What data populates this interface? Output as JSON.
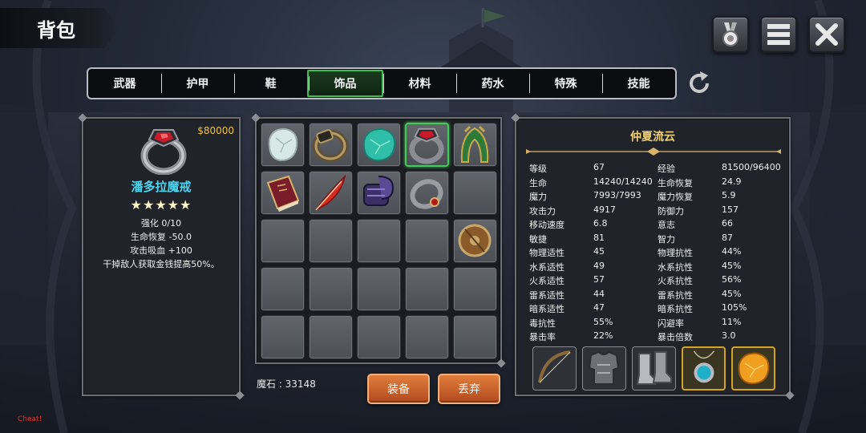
{
  "header": {
    "title": "背包"
  },
  "top_buttons": [
    {
      "icon": "medal-icon"
    },
    {
      "icon": "menu-icon"
    },
    {
      "icon": "close-icon"
    }
  ],
  "tabs": [
    {
      "label": "武器",
      "active": false
    },
    {
      "label": "护甲",
      "active": false
    },
    {
      "label": "鞋",
      "active": false
    },
    {
      "label": "饰品",
      "active": true
    },
    {
      "label": "材料",
      "active": false
    },
    {
      "label": "药水",
      "active": false
    },
    {
      "label": "特殊",
      "active": false
    },
    {
      "label": "技能",
      "active": false
    }
  ],
  "detail": {
    "price": "$80000",
    "name": "潘多拉魔戒",
    "stars": "★★★★★",
    "lines": [
      "强化 0/10",
      "生命恢复  -50.0",
      "攻击吸血  +100",
      "干掉敌人获取金钱提高50%。"
    ],
    "icon": "ruby-ring-icon"
  },
  "inventory": [
    {
      "icon": "white-gem-icon",
      "selected": false
    },
    {
      "icon": "gold-ring-icon",
      "selected": false
    },
    {
      "icon": "teal-gem-icon",
      "selected": false
    },
    {
      "icon": "ruby-ring-icon",
      "selected": true
    },
    {
      "icon": "green-hood-icon",
      "selected": false
    },
    {
      "icon": "red-book-icon",
      "selected": false
    },
    {
      "icon": "red-feather-icon",
      "selected": false
    },
    {
      "icon": "purple-gauntlet-icon",
      "selected": false
    },
    {
      "icon": "silver-ring-icon",
      "selected": false
    },
    {
      "icon": "",
      "selected": false
    },
    {
      "icon": "",
      "selected": false
    },
    {
      "icon": "",
      "selected": false
    },
    {
      "icon": "",
      "selected": false
    },
    {
      "icon": "",
      "selected": false
    },
    {
      "icon": "round-shield-icon",
      "selected": false
    },
    {
      "icon": "",
      "selected": false
    },
    {
      "icon": "",
      "selected": false
    },
    {
      "icon": "",
      "selected": false
    },
    {
      "icon": "",
      "selected": false
    },
    {
      "icon": "",
      "selected": false
    },
    {
      "icon": "",
      "selected": false
    },
    {
      "icon": "",
      "selected": false
    },
    {
      "icon": "",
      "selected": false
    },
    {
      "icon": "",
      "selected": false
    },
    {
      "icon": "",
      "selected": false
    }
  ],
  "mana_stone": "魔石 : 33148",
  "buttons": {
    "equip": "装备",
    "discard": "丢弃"
  },
  "character": {
    "name": "仲夏流云",
    "stats": [
      [
        "等级",
        "67",
        "经验",
        "81500/96400"
      ],
      [
        "生命",
        "14240/14240",
        "生命恢复",
        "24.9"
      ],
      [
        "魔力",
        "7993/7993",
        "魔力恢复",
        "5.9"
      ],
      [
        "攻击力",
        "4917",
        "防御力",
        "157"
      ],
      [
        "移动速度",
        "6.8",
        "意志",
        "66"
      ],
      [
        "敏捷",
        "81",
        "智力",
        "87"
      ],
      [
        "物理适性",
        "45",
        "物理抗性",
        "44%"
      ],
      [
        "水系适性",
        "49",
        "水系抗性",
        "45%"
      ],
      [
        "火系适性",
        "57",
        "火系抗性",
        "56%"
      ],
      [
        "雷系适性",
        "44",
        "雷系抗性",
        "45%"
      ],
      [
        "暗系适性",
        "47",
        "暗系抗性",
        "105%"
      ],
      [
        "毒抗性",
        "55%",
        "闪避率",
        "11%"
      ],
      [
        "暴击率",
        "22%",
        "暴击倍数",
        "3.0"
      ]
    ],
    "equipment": [
      {
        "icon": "bow-icon",
        "gold": false
      },
      {
        "icon": "chest-armor-icon",
        "gold": false
      },
      {
        "icon": "greaves-icon",
        "gold": false
      },
      {
        "icon": "teal-amulet-icon",
        "gold": true
      },
      {
        "icon": "orange-gem-icon",
        "gold": true
      }
    ]
  },
  "debug": "Cheat!"
}
